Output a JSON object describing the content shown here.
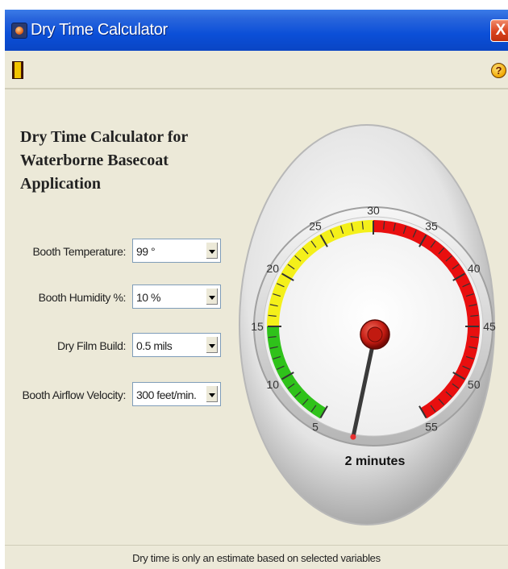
{
  "window": {
    "title": "Dry Time Calculator",
    "close_glyph": "X"
  },
  "toolbar": {
    "left_icon": "exit-icon",
    "help_glyph": "?"
  },
  "heading": {
    "line1": "Dry Time Calculator for",
    "line2": "Waterborne Basecoat Application"
  },
  "form": [
    {
      "label": "Booth Temperature:",
      "value": "99 °"
    },
    {
      "label": "Booth Humidity %:",
      "value": "10 %"
    },
    {
      "label": "Dry Film Build:",
      "value": "0.5 mils"
    },
    {
      "label": "Booth Airflow Velocity:",
      "value": "300 feet/min."
    }
  ],
  "gauge": {
    "min": 5,
    "max": 55,
    "value": 2,
    "ticks": [
      "5",
      "10",
      "15",
      "20",
      "25",
      "30",
      "35",
      "40",
      "45",
      "50",
      "55"
    ],
    "zones": [
      {
        "from": 5,
        "to": 15,
        "color": "#2fc21a"
      },
      {
        "from": 15,
        "to": 30,
        "color": "#f4f01a"
      },
      {
        "from": 30,
        "to": 55,
        "color": "#e80f0f"
      }
    ],
    "readout": "2 minutes"
  },
  "footer": {
    "text": "Dry time is only an estimate based on selected variables"
  }
}
